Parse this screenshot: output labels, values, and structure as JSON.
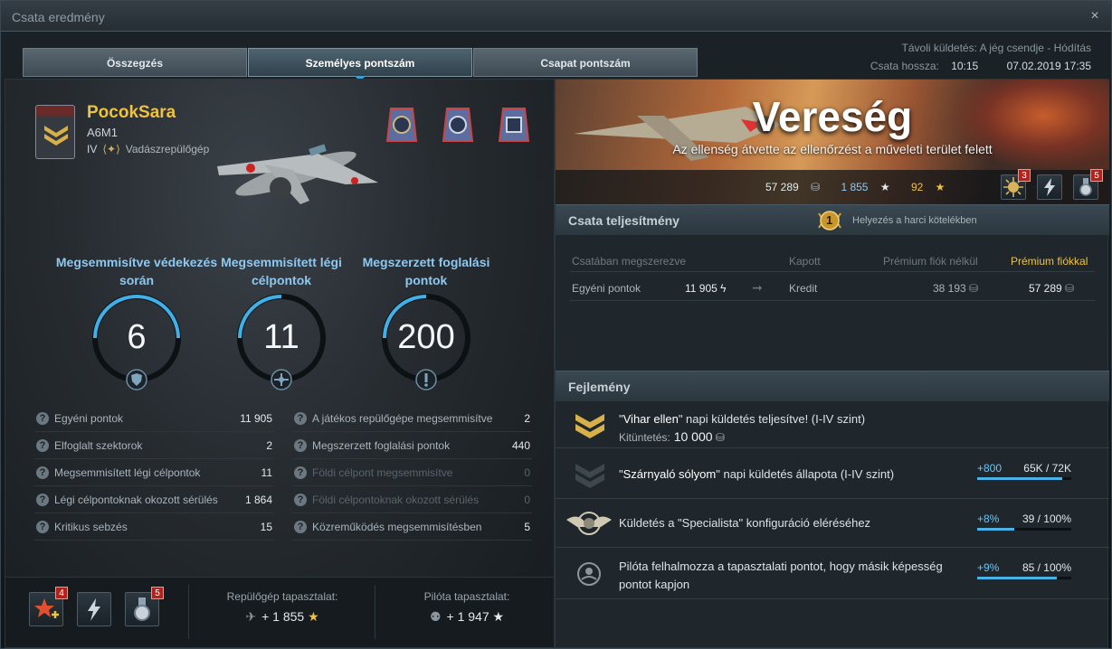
{
  "window": {
    "title": "Csata eredmény",
    "close_glyph": "×"
  },
  "tabs": [
    {
      "label": "Összegzés"
    },
    {
      "label": "Személyes pontszám"
    },
    {
      "label": "Csapat pontszám"
    }
  ],
  "meta": {
    "mission": "Távoli küldetés: A jég csendje - Hódítás",
    "duration_label": "Csata hossza:",
    "duration": "10:15",
    "date": "07.02.2019 17:35"
  },
  "player": {
    "name": "PocokSara",
    "plane": "A6M1",
    "tier": "IV",
    "class": "Vadászrepülőgép"
  },
  "circles": [
    {
      "label": "Megsemmisítve védekezés során",
      "value": "6",
      "icon": "shield-icon"
    },
    {
      "label": "Megsemmisített légi célpontok",
      "value": "11",
      "icon": "crosshair-plane-icon"
    },
    {
      "label": "Megszerzett foglalási pontok",
      "value": "200",
      "icon": "capture-point-icon"
    }
  ],
  "stats_left": [
    {
      "name": "Egyéni pontok",
      "value": "11 905"
    },
    {
      "name": "Elfoglalt szektorok",
      "value": "2"
    },
    {
      "name": "Megsemmisített légi célpontok",
      "value": "11"
    },
    {
      "name": "Légi célpontoknak okozott sérülés",
      "value": "1 864"
    },
    {
      "name": "Kritikus sebzés",
      "value": "15"
    }
  ],
  "stats_right": [
    {
      "name": "A játékos repülőgépe megsemmisítve",
      "value": "2",
      "dim": false
    },
    {
      "name": "Megszerzett foglalási pontok",
      "value": "440",
      "dim": false
    },
    {
      "name": "Földi célpont megsemmisítve",
      "value": "0",
      "dim": true
    },
    {
      "name": "Földi célpontoknak okozott sérülés",
      "value": "0",
      "dim": true
    },
    {
      "name": "Közreműködés megsemmisítésben",
      "value": "5",
      "dim": false
    }
  ],
  "bottom_left": {
    "icon_counts": [
      "4",
      "5"
    ],
    "plane_xp_label": "Repülőgép tapasztalat:",
    "plane_xp": "+ 1 855",
    "pilot_xp_label": "Pilóta tapasztalat:",
    "pilot_xp": "+ 1 947"
  },
  "result": {
    "title": "Vereség",
    "subtitle": "Az ellenség átvette az ellenőrzést a műveleti terület felett",
    "credits": "57 289",
    "xp": "1 855",
    "stars": "92",
    "icon_counts": [
      "3",
      "5"
    ]
  },
  "performance": {
    "heading": "Csata teljesítmény",
    "placement_rank": "1",
    "placement_text": "Helyezés a harci kötelékben",
    "col_earned": "Csatában megszerezve",
    "col_received": "Kapott",
    "col_no_premium": "Prémium fiók nélkül",
    "col_premium": "Prémium fiókkal",
    "row_label": "Egyéni pontok",
    "row_value": "11 905",
    "row_received": "Kredit",
    "row_no_premium": "38 193",
    "row_premium": "57 289",
    "arrow": "➞"
  },
  "development": {
    "heading": "Fejlemény",
    "items": [
      {
        "pre": "\"",
        "title": "Vihar ellen",
        "post": "\" napi küldetés teljesítve!  (I-IV szint)",
        "reward_label": "Kitüntetés:",
        "reward_value": "10 000"
      },
      {
        "pre": "\"",
        "title": "Szárnyaló sólyom",
        "post": "\" napi küldetés állapota  (I-IV szint)",
        "plus": "+800",
        "progress": "65K / 72K",
        "fill": 0.9
      },
      {
        "text": "Küldetés a \"Specialista\" konfiguráció eléréséhez",
        "plus": "+8%",
        "progress": "39 / 100%",
        "fill": 0.39
      },
      {
        "text": "Pilóta felhalmozza a tapasztalati pontot, hogy másik képesség pontot kapjon",
        "plus": "+9%",
        "progress": "85 / 100%",
        "fill": 0.85
      }
    ]
  },
  "colors": {
    "accent_blue": "#3c9fd2",
    "gold": "#f0c33c",
    "loss_red": "#b3221b"
  }
}
